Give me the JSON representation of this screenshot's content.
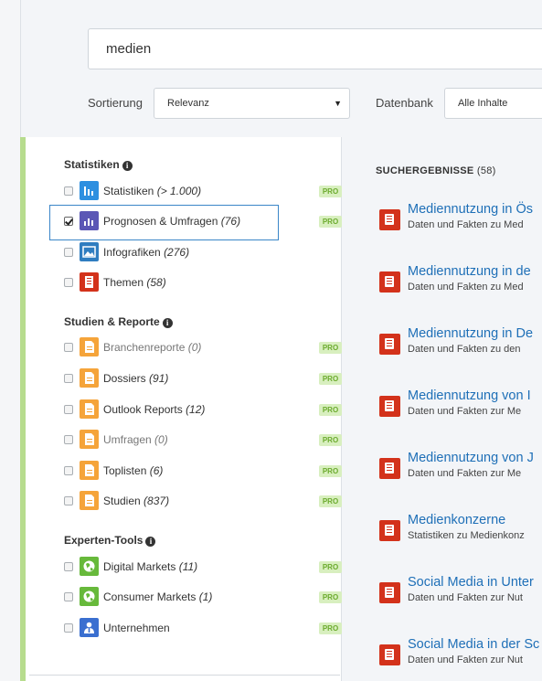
{
  "search": {
    "value": "medien"
  },
  "sort": {
    "label": "Sortierung",
    "selected": "Relevanz"
  },
  "database": {
    "label": "Datenbank",
    "selected": "Alle Inhalte"
  },
  "filters": {
    "statistiken": {
      "title": "Statistiken",
      "items": [
        {
          "label": "Statistiken",
          "count": "(> 1.000)",
          "pro": "PRO",
          "checked": false,
          "icon": "bar-chart-icon"
        },
        {
          "label": "Prognosen & Umfragen",
          "count": "(76)",
          "pro": "PRO",
          "checked": true,
          "icon": "forecast-chart-icon"
        },
        {
          "label": "Infografiken",
          "count": "(276)",
          "checked": false,
          "icon": "image-icon"
        },
        {
          "label": "Themen",
          "count": "(58)",
          "checked": false,
          "icon": "dossier-icon"
        }
      ]
    },
    "studien": {
      "title": "Studien & Reporte",
      "items": [
        {
          "label": "Branchenreporte",
          "count": "(0)",
          "pro": "PRO",
          "checked": false,
          "icon": "document-icon"
        },
        {
          "label": "Dossiers",
          "count": "(91)",
          "pro": "PRO",
          "checked": false,
          "icon": "document-icon"
        },
        {
          "label": "Outlook Reports",
          "count": "(12)",
          "pro": "PRO",
          "checked": false,
          "icon": "document-icon"
        },
        {
          "label": "Umfragen",
          "count": "(0)",
          "pro": "PRO",
          "checked": false,
          "icon": "document-icon"
        },
        {
          "label": "Toplisten",
          "count": "(6)",
          "pro": "PRO",
          "checked": false,
          "icon": "document-icon"
        },
        {
          "label": "Studien",
          "count": "(837)",
          "pro": "PRO",
          "checked": false,
          "icon": "document-icon"
        }
      ]
    },
    "experten": {
      "title": "Experten-Tools",
      "items": [
        {
          "label": "Digital Markets",
          "count": "(11)",
          "pro": "PRO",
          "checked": false,
          "icon": "globe-icon"
        },
        {
          "label": "Consumer Markets",
          "count": "(1)",
          "pro": "PRO",
          "checked": false,
          "icon": "globe-icon"
        },
        {
          "label": "Unternehmen",
          "count": "",
          "pro": "PRO",
          "checked": false,
          "icon": "company-icon"
        }
      ]
    }
  },
  "results": {
    "title": "SUCHERGEBNISSE",
    "count": "(58)",
    "items": [
      {
        "title": "Mediennutzung in Ös",
        "subtitle": "Daten und Fakten zu Med"
      },
      {
        "title": "Mediennutzung in de",
        "subtitle": "Daten und Fakten zu Med"
      },
      {
        "title": "Mediennutzung in De",
        "subtitle": "Daten und Fakten zu den"
      },
      {
        "title": "Mediennutzung von I",
        "subtitle": "Daten und Fakten zur Me"
      },
      {
        "title": "Mediennutzung von J",
        "subtitle": "Daten und Fakten zur Me"
      },
      {
        "title": "Medienkonzerne",
        "subtitle": "Statistiken zu Medienkonz"
      },
      {
        "title": "Social Media in Unter",
        "subtitle": "Daten und Fakten zur Nut"
      },
      {
        "title": "Social Media in der Sc",
        "subtitle": "Daten und Fakten zur Nut"
      }
    ]
  },
  "colors": {
    "link": "#1e6fb7",
    "pro_bg": "#d8efbf",
    "pro_text": "#6cab2e",
    "accent_green": "#b7dc8e",
    "highlight_border": "#3a86c8",
    "dossier_red": "#d3321b",
    "document_orange": "#f5a43a",
    "globe_green": "#67b93b",
    "stat_blue": "#2d8fe0"
  }
}
